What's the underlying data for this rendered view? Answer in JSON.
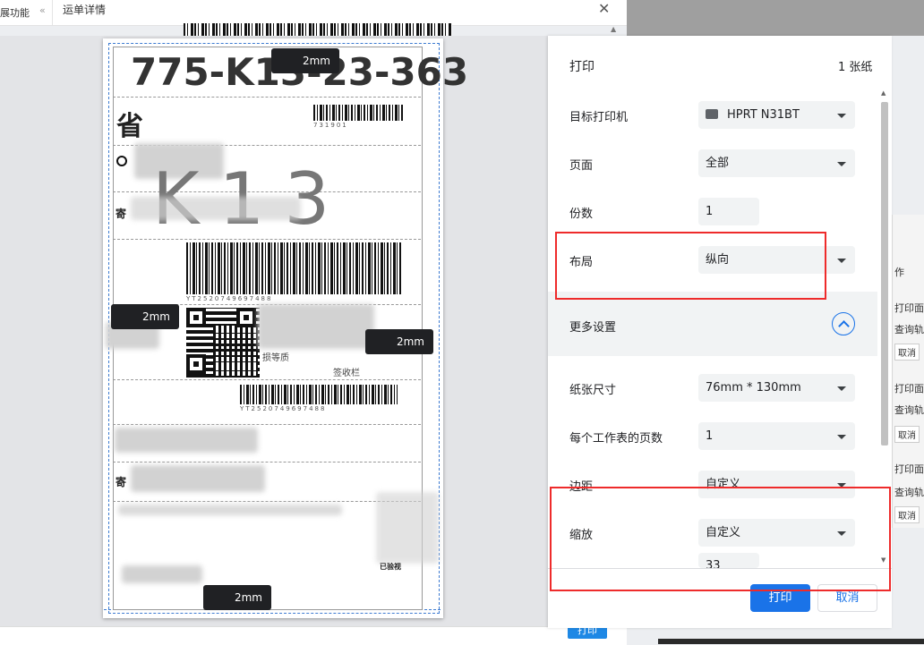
{
  "app": {
    "left_tab": "展功能",
    "collapse": "«",
    "dialog_title": "运单详情",
    "close": "✕",
    "bg_print": "打印",
    "bg_right": {
      "header": "作",
      "groups": [
        {
          "print": "打印面单",
          "query": "查询轨迹",
          "cancel": "取消"
        },
        {
          "print": "打印面单",
          "query": "查询轨迹",
          "cancel": "取消"
        },
        {
          "print": "打印面单",
          "query": "查询轨迹",
          "cancel": "取消"
        }
      ]
    }
  },
  "label": {
    "tracking": "775-K13-23-363",
    "province": "省",
    "big_code": "K13",
    "sender_char": "寄",
    "sender_char2": "寄",
    "barcode_text_top": "731901",
    "barcode_text_main": "YT2520749697488",
    "barcode_text_bottom": "YT2520749697488",
    "sign": "签收栏",
    "damage": "损等质",
    "checked": "已验视",
    "margins": [
      "2mm",
      "2mm",
      "2mm",
      "2mm"
    ]
  },
  "print": {
    "title": "打印",
    "count": "1 张纸",
    "printer_label": "目标打印机",
    "printer_value": "HPRT N31BT",
    "pages_label": "页面",
    "pages_value": "全部",
    "copies_label": "份数",
    "copies_value": "1",
    "layout_label": "布局",
    "layout_value": "纵向",
    "more_label": "更多设置",
    "paper_label": "纸张尺寸",
    "paper_value": "76mm * 130mm",
    "per_sheet_label": "每个工作表的页数",
    "per_sheet_value": "1",
    "margin_label": "边距",
    "margin_value": "自定义",
    "scale_label": "缩放",
    "scale_value": "自定义",
    "scale_input": "33",
    "print_button": "打印",
    "cancel_button": "取消"
  },
  "colors": {
    "accent": "#1a73e8",
    "highlight": "#ee2b2b"
  }
}
